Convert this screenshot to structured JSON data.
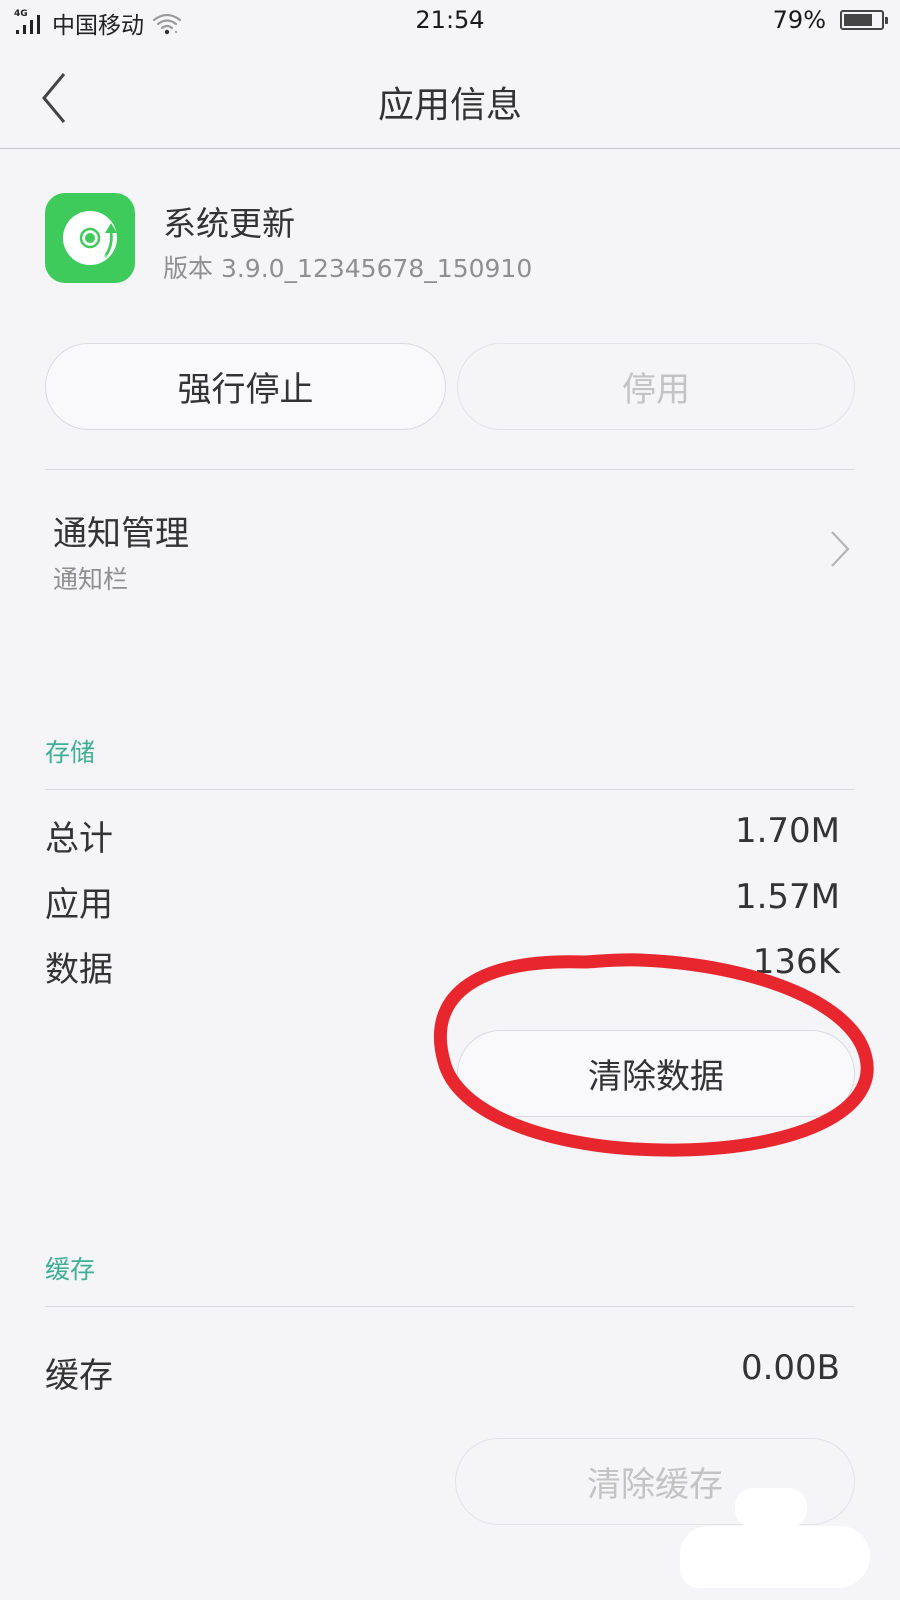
{
  "status_bar": {
    "network_type": "4G",
    "carrier": "中国移动",
    "time": "21:54",
    "battery_percent_label": "79%",
    "battery_level": 0.79
  },
  "header": {
    "back_icon": "chevron-left-icon",
    "title": "应用信息"
  },
  "app": {
    "icon": "system-update-disc-icon",
    "icon_color": "#3fcb5b",
    "name": "系统更新",
    "version": "版本 3.9.0_12345678_150910"
  },
  "actions": {
    "force_stop_label": "强行停止",
    "disable_label": "停用",
    "disable_enabled": false
  },
  "notification": {
    "title": "通知管理",
    "subtitle": "通知栏",
    "chevron_icon": "chevron-right-icon"
  },
  "storage": {
    "section_label": "存储",
    "accent_color": "#3fae95",
    "rows": [
      {
        "label": "总计",
        "value": "1.70M"
      },
      {
        "label": "应用",
        "value": "1.57M"
      },
      {
        "label": "数据",
        "value": "136K"
      }
    ],
    "clear_data_label": "清除数据"
  },
  "cache": {
    "section_label": "缓存",
    "rows": [
      {
        "label": "缓存",
        "value": "0.00B"
      }
    ],
    "clear_cache_label": "清除缓存",
    "clear_cache_enabled": false
  },
  "annotation": {
    "type": "hand-drawn-circle",
    "color": "#e8262d",
    "target": "clear-data-button"
  }
}
